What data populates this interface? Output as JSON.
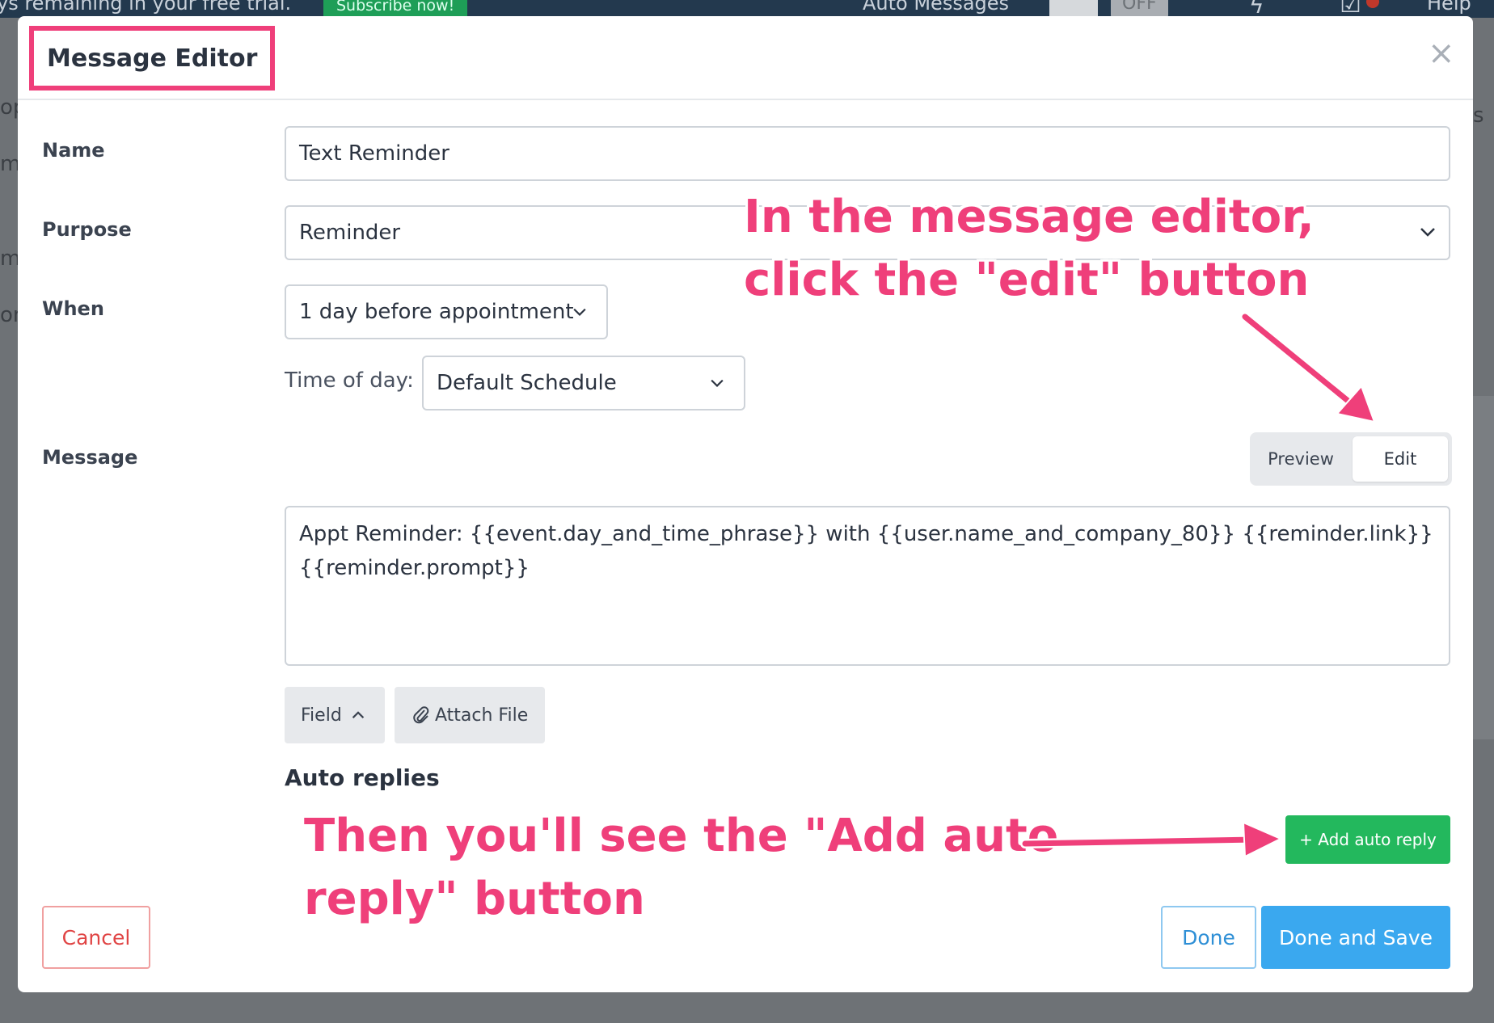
{
  "background": {
    "trial_text": "ys remaining in your free trial.",
    "subscribe_label": "Subscribe now!",
    "auto_messages_label": "Auto Messages",
    "off_label": "OFF",
    "help_label": "Help",
    "side_fragments": [
      "op",
      "m",
      "m",
      "on"
    ],
    "right_fragments": [
      "s"
    ]
  },
  "modal": {
    "title": "Message Editor",
    "close_glyph": "×",
    "labels": {
      "name": "Name",
      "purpose": "Purpose",
      "when": "When",
      "message": "Message"
    },
    "name_value": "Text Reminder",
    "purpose_value": "Reminder",
    "when_value": "1 day before appointment",
    "time_of_day_label": "Time of day:",
    "time_of_day_value": "Default Schedule",
    "toggle": {
      "preview": "Preview",
      "edit": "Edit"
    },
    "message_line1": "Appt Reminder: {{event.day_and_time_phrase}} with {{user.name_and_company_80}} {{reminder.link}}",
    "message_line2": "{{reminder.prompt}}",
    "field_button": "Field",
    "attach_button": "Attach File",
    "auto_replies_heading": "Auto replies",
    "add_auto_reply": "+ Add auto reply",
    "cancel": "Cancel",
    "done": "Done",
    "done_and_save": "Done and Save"
  },
  "annotations": {
    "top_line1": "In the message editor,",
    "top_line2": "click the \"edit\" button",
    "bottom_line1": "Then you'll see the \"Add auto",
    "bottom_line2": "reply\" button"
  },
  "colors": {
    "accent_pink": "#ef3f7a",
    "green": "#23b85d",
    "blue": "#3aa8ef",
    "cancel_red": "#e04444"
  },
  "icons": {
    "chevron": "chevron-down-icon",
    "chevron_up": "chevron-up-icon",
    "paperclip": "paperclip-icon",
    "close": "close-icon",
    "bolt": "lightning-icon",
    "check": "checkbox-icon"
  }
}
